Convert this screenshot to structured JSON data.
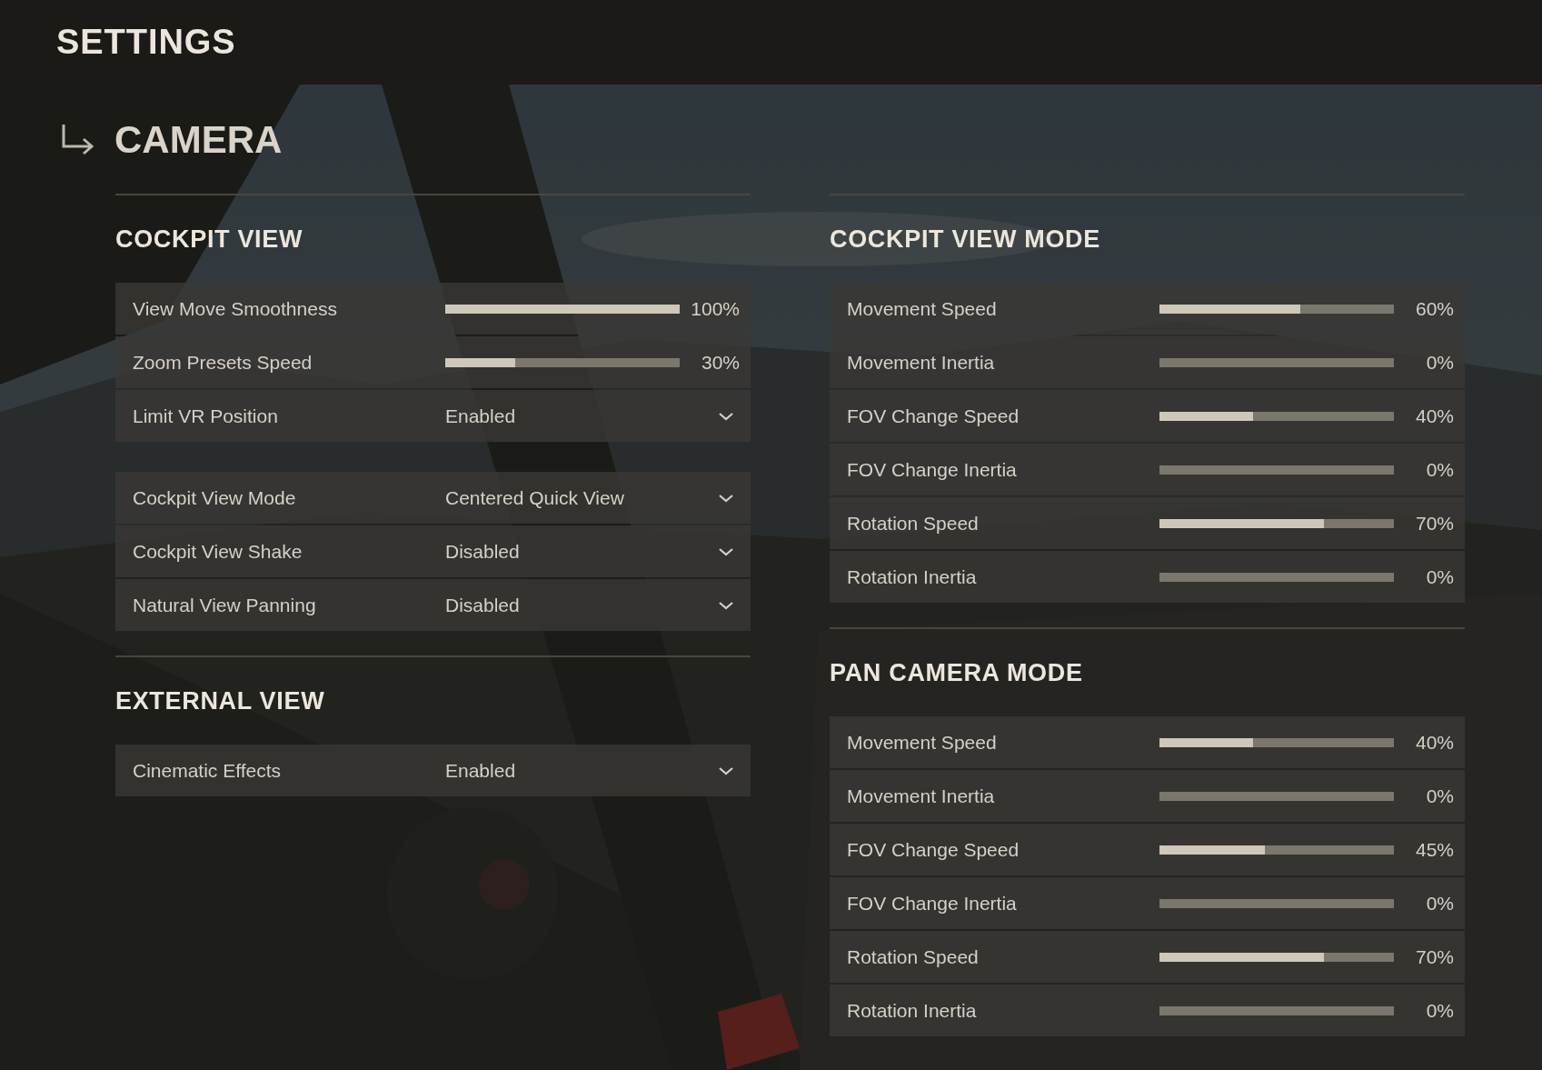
{
  "header": {
    "title": "SETTINGS"
  },
  "section": {
    "title": "CAMERA"
  },
  "columns": [
    [
      {
        "title": "COCKPIT VIEW",
        "blocks": [
          [
            {
              "kind": "slider",
              "label": "View Move Smoothness",
              "level": 1.0,
              "reading": "100%"
            },
            {
              "kind": "slider",
              "label": "Zoom Presets Speed",
              "level": 0.3,
              "reading": "30%"
            },
            {
              "kind": "dropdown",
              "label": "Limit VR Position",
              "value": "Enabled"
            }
          ],
          [
            {
              "kind": "dropdown",
              "label": "Cockpit View Mode",
              "value": "Centered Quick View"
            },
            {
              "kind": "dropdown",
              "label": "Cockpit View Shake",
              "value": "Disabled"
            },
            {
              "kind": "dropdown",
              "label": "Natural View Panning",
              "value": "Disabled"
            }
          ]
        ]
      },
      {
        "title": "EXTERNAL VIEW",
        "blocks": [
          [
            {
              "kind": "dropdown",
              "label": "Cinematic Effects",
              "value": "Enabled"
            }
          ]
        ]
      }
    ],
    [
      {
        "title": "COCKPIT VIEW MODE",
        "blocks": [
          [
            {
              "kind": "slider",
              "label": "Movement Speed",
              "level": 0.6,
              "reading": "60%"
            },
            {
              "kind": "slider",
              "label": "Movement Inertia",
              "level": 0,
              "reading": "0%"
            },
            {
              "kind": "slider",
              "label": "FOV Change Speed",
              "level": 0.4,
              "reading": "40%"
            },
            {
              "kind": "slider",
              "label": "FOV Change Inertia",
              "level": 0,
              "reading": "0%"
            },
            {
              "kind": "slider",
              "label": "Rotation Speed",
              "level": 0.7,
              "reading": "70%"
            },
            {
              "kind": "slider",
              "label": "Rotation Inertia",
              "level": 0,
              "reading": "0%"
            }
          ]
        ]
      },
      {
        "title": "PAN CAMERA MODE",
        "blocks": [
          [
            {
              "kind": "slider",
              "label": "Movement Speed",
              "level": 0.4,
              "reading": "40%"
            },
            {
              "kind": "slider",
              "label": "Movement Inertia",
              "level": 0,
              "reading": "0%"
            },
            {
              "kind": "slider",
              "label": "FOV Change Speed",
              "level": 0.45,
              "reading": "45%"
            },
            {
              "kind": "slider",
              "label": "FOV Change Inertia",
              "level": 0,
              "reading": "0%"
            },
            {
              "kind": "slider",
              "label": "Rotation Speed",
              "level": 0.7,
              "reading": "70%"
            },
            {
              "kind": "slider",
              "label": "Rotation Inertia",
              "level": 0,
              "reading": "0%"
            }
          ]
        ]
      }
    ]
  ]
}
